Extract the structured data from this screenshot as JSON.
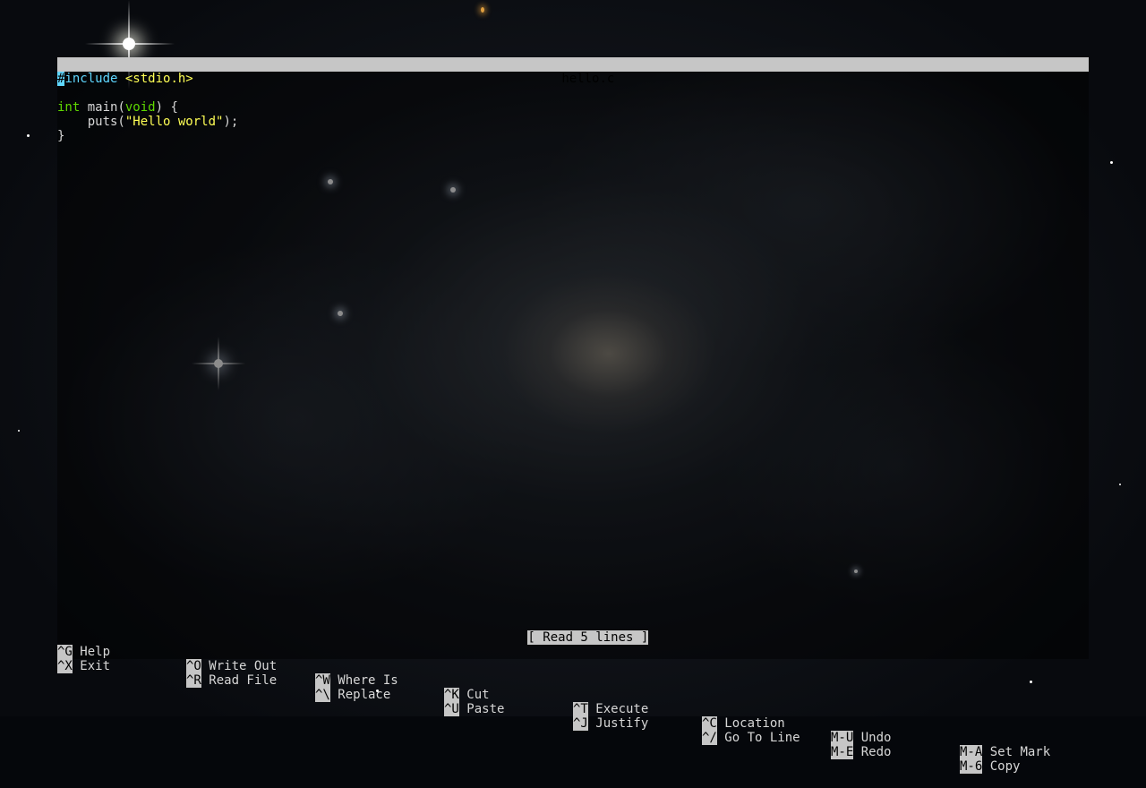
{
  "editor": {
    "title": "hello.c",
    "code": {
      "line1": {
        "cursor_char": "#",
        "directive": "include",
        "header": " <stdio.h>"
      },
      "line3": {
        "type": "int",
        "name": " main(",
        "param": "void",
        "rest": ") {"
      },
      "line4": {
        "indent": "    puts(",
        "string": "\"Hello world\"",
        "rest": ");"
      },
      "line5": {
        "text": "}"
      }
    },
    "status_message": "[ Read 5 lines ]",
    "shortcuts": {
      "top": [
        {
          "key": "^G",
          "label": " Help"
        },
        {
          "key": "^O",
          "label": " Write Out"
        },
        {
          "key": "^W",
          "label": " Where Is"
        },
        {
          "key": "^K",
          "label": " Cut"
        },
        {
          "key": "^T",
          "label": " Execute"
        },
        {
          "key": "^C",
          "label": " Location"
        },
        {
          "key": "M-U",
          "label": " Undo"
        },
        {
          "key": "M-A",
          "label": " Set Mark"
        }
      ],
      "bottom": [
        {
          "key": "^X",
          "label": " Exit"
        },
        {
          "key": "^R",
          "label": " Read File"
        },
        {
          "key": "^\\",
          "label": " Replace"
        },
        {
          "key": "^U",
          "label": " Paste"
        },
        {
          "key": "^J",
          "label": " Justify"
        },
        {
          "key": "^/",
          "label": " Go To Line"
        },
        {
          "key": "M-E",
          "label": " Redo"
        },
        {
          "key": "M-6",
          "label": " Copy"
        }
      ]
    }
  },
  "colors": {
    "title_bar_bg": "#c6c6c6",
    "type_keyword": "#5fd700",
    "preprocessor": "#5fd7ff",
    "string_literal": "#ffff55",
    "default_text": "#d7d7d7"
  }
}
